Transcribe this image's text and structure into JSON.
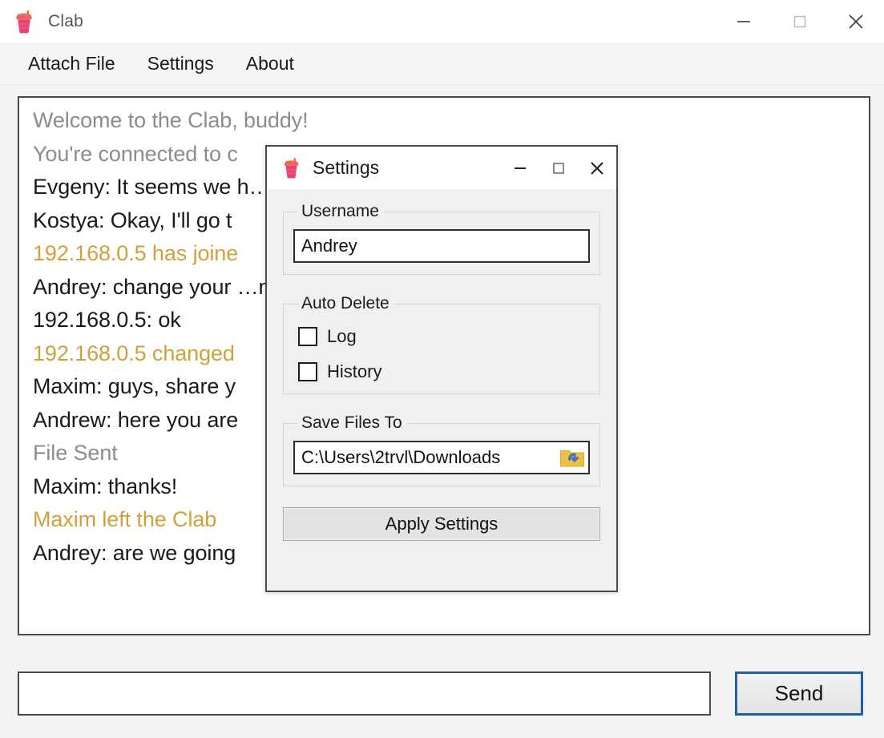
{
  "app": {
    "title": "Clab",
    "icon": "cup-icon",
    "accent_gold": "#cfa13a",
    "accent_blue": "#1f5fa9",
    "brand_pink": "#e8456b"
  },
  "titlebar": {
    "minimize_label": "Minimize",
    "maximize_label": "Maximize",
    "close_label": "Close"
  },
  "menubar": {
    "items": [
      {
        "label": "Attach File",
        "name": "menu-attach-file"
      },
      {
        "label": "Settings",
        "name": "menu-settings"
      },
      {
        "label": "About",
        "name": "menu-about"
      }
    ]
  },
  "chat": {
    "lines": [
      {
        "text": "Welcome to the Clab, buddy!",
        "kind": "system"
      },
      {
        "text": "You're connected to с",
        "kind": "system"
      },
      {
        "text": "Evgeny: It seems we h…rs in the living room..",
        "kind": "message"
      },
      {
        "text": "Kostya: Okay, I'll go t",
        "kind": "message"
      },
      {
        "text": "192.168.0.5 has joine",
        "kind": "status"
      },
      {
        "text": "Andrey: change your …n the settings",
        "kind": "message"
      },
      {
        "text": "192.168.0.5: ok",
        "kind": "message"
      },
      {
        "text": "192.168.0.5 changed",
        "kind": "status"
      },
      {
        "text": "Maxim: guys, share y",
        "kind": "message"
      },
      {
        "text": "Andrew: here you are",
        "kind": "message"
      },
      {
        "text": "File Sent",
        "kind": "system"
      },
      {
        "text": "Maxim: thanks!",
        "kind": "message"
      },
      {
        "text": "Maxim left the Clab",
        "kind": "status"
      },
      {
        "text": "Andrey: are we going",
        "kind": "message"
      }
    ]
  },
  "composer": {
    "message_value": "",
    "message_placeholder": "",
    "send_label": "Send"
  },
  "settings_dialog": {
    "title": "Settings",
    "icon": "cup-icon",
    "minimize_label": "Minimize",
    "maximize_label": "Maximize",
    "close_label": "Close",
    "username": {
      "legend": "Username",
      "value": "Andrey",
      "placeholder": ""
    },
    "auto_delete": {
      "legend": "Auto Delete",
      "options": [
        {
          "label": "Log",
          "checked": false
        },
        {
          "label": "History",
          "checked": false
        }
      ]
    },
    "save_files_to": {
      "legend": "Save Files To",
      "value": "C:\\Users\\2trvl\\Downloads",
      "placeholder": "",
      "browse_icon": "open-folder-icon"
    },
    "apply_label": "Apply Settings"
  }
}
